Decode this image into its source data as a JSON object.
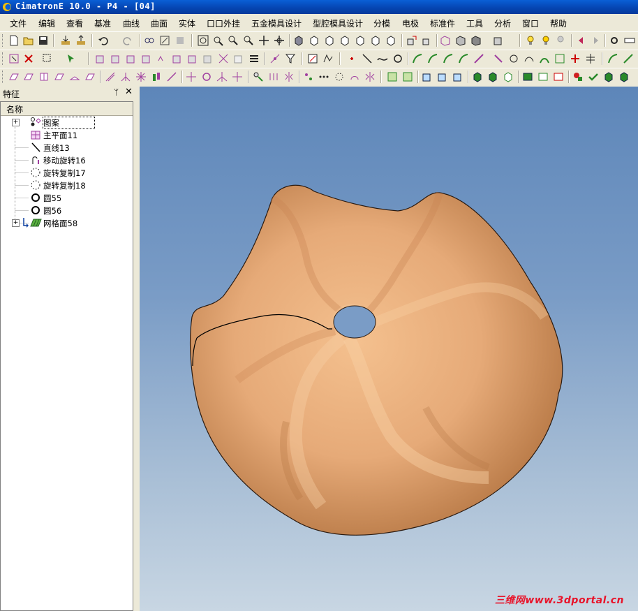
{
  "window": {
    "title": "CimatronE 10.0 - P4 - [04]"
  },
  "menu": [
    "文件",
    "编辑",
    "查看",
    "基准",
    "曲线",
    "曲面",
    "实体",
    "口口外挂",
    "五金模具设计",
    "型腔模具设计",
    "分模",
    "电极",
    "标准件",
    "工具",
    "分析",
    "窗口",
    "帮助"
  ],
  "panel": {
    "title": "特征",
    "pin_label": "ᛘ",
    "close_label": "✕",
    "column_header": "名称"
  },
  "features": [
    {
      "label": "图案",
      "icon": "pattern-icon",
      "expandable": true,
      "selected": true
    },
    {
      "label": "主平面11",
      "icon": "main-plane-icon",
      "expandable": false
    },
    {
      "label": "直线13",
      "icon": "line-icon",
      "expandable": false
    },
    {
      "label": "移动旋转16",
      "icon": "move-rotate-icon",
      "expandable": false
    },
    {
      "label": "旋转复制17",
      "icon": "rotate-copy-icon",
      "expandable": false
    },
    {
      "label": "旋转复制18",
      "icon": "rotate-copy-icon",
      "expandable": false
    },
    {
      "label": "圆55",
      "icon": "circle-icon",
      "expandable": false
    },
    {
      "label": "圆56",
      "icon": "circle-icon",
      "expandable": false
    },
    {
      "label": "网格面58",
      "icon": "mesh-surface-icon",
      "expandable": true
    }
  ],
  "viewport": {
    "model_color": "#e6aa78",
    "background_top": "#5d86b9",
    "background_bottom": "#c8d6e3"
  },
  "watermark": "三维网www.3dportal.cn"
}
